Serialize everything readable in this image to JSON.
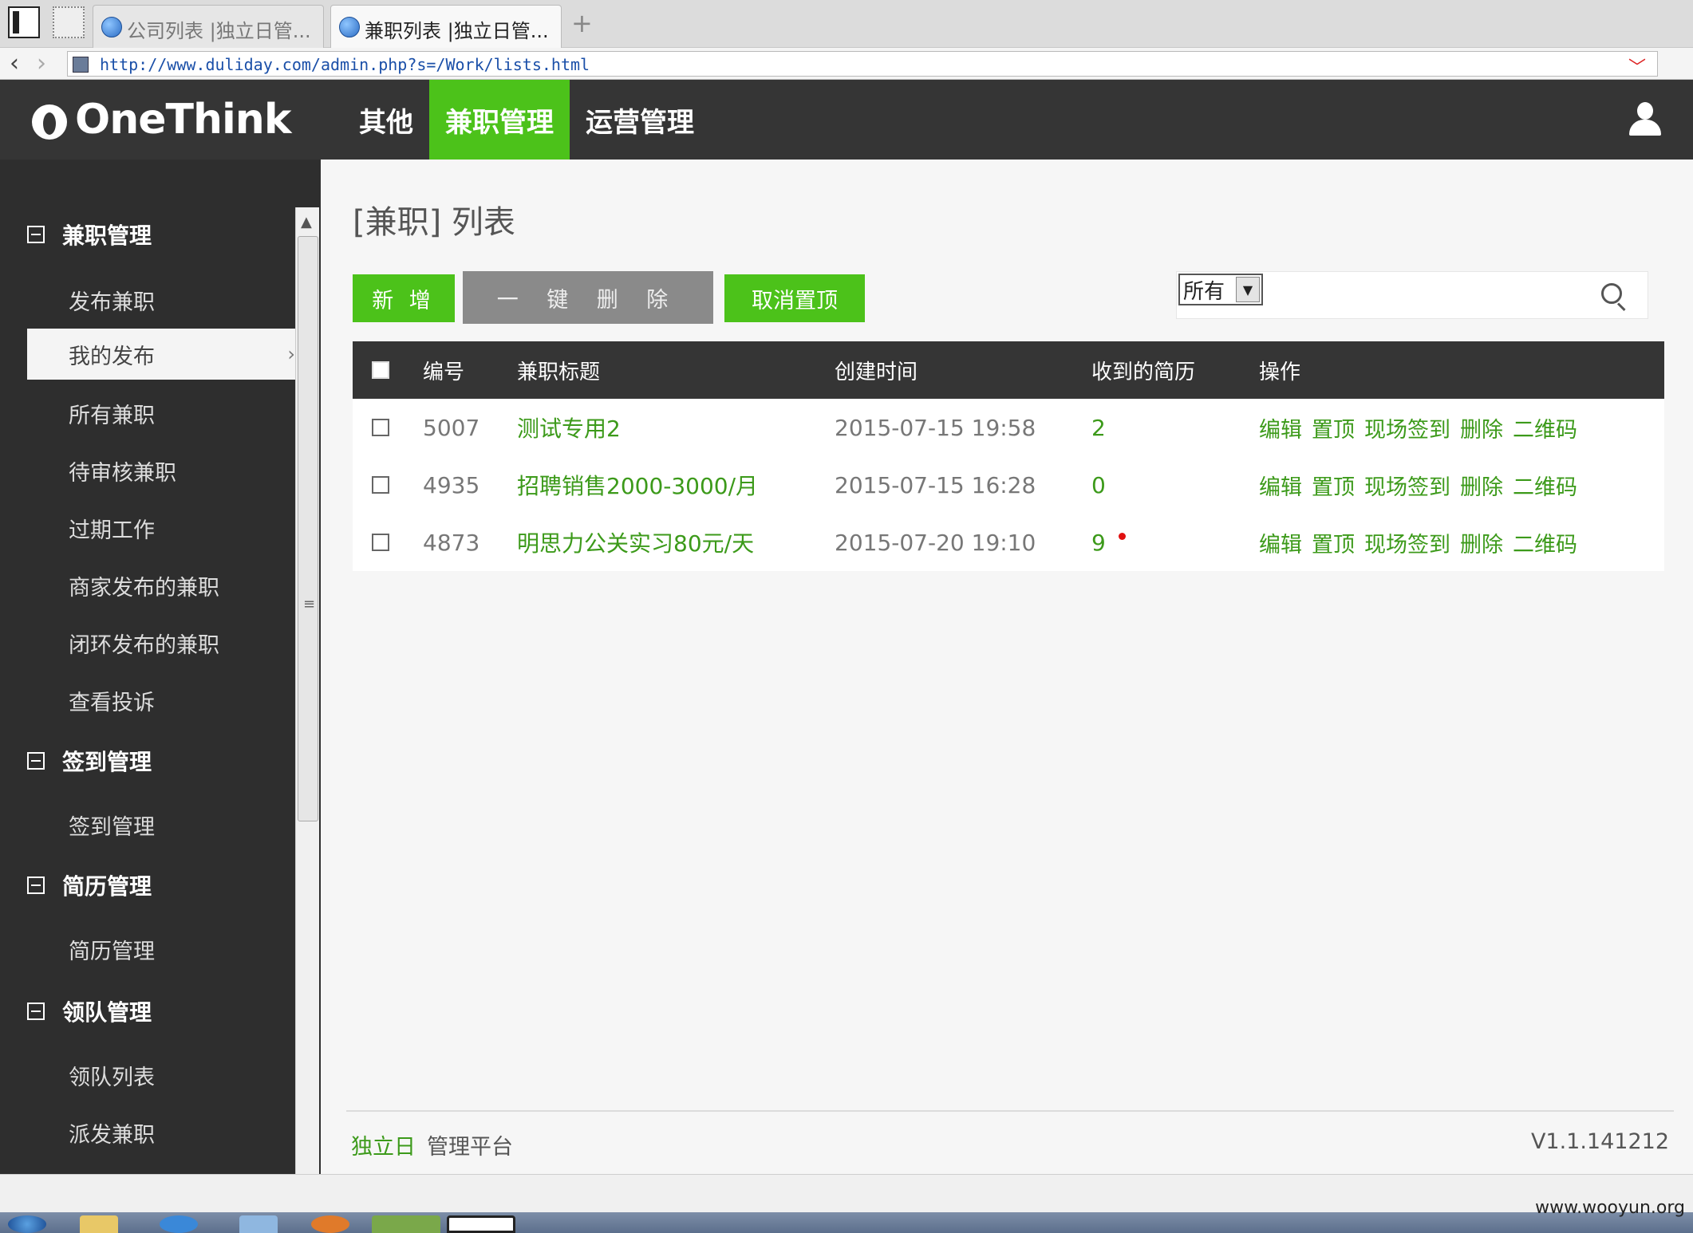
{
  "browser": {
    "tabs": [
      {
        "label": "公司列表 |独立日管..."
      },
      {
        "label": "兼职列表 |独立日管..."
      }
    ],
    "new_tab": "+",
    "url": "http://www.duliday.com/admin.php?s=/Work/lists.html"
  },
  "header": {
    "logo": "OneThink",
    "nav": [
      {
        "label": "其他"
      },
      {
        "label": "兼职管理"
      },
      {
        "label": "运营管理"
      }
    ]
  },
  "sidebar": {
    "groups": [
      {
        "label": "兼职管理",
        "items": [
          "发布兼职",
          "我的发布",
          "所有兼职",
          "待审核兼职",
          "过期工作",
          "商家发布的兼职",
          "闭环发布的兼职",
          "查看投诉"
        ]
      },
      {
        "label": "签到管理",
        "items": [
          "签到管理"
        ]
      },
      {
        "label": "简历管理",
        "items": [
          "简历管理"
        ]
      },
      {
        "label": "领队管理",
        "items": [
          "领队列表",
          "派发兼职"
        ]
      }
    ],
    "active_item": "我的发布"
  },
  "main": {
    "title": "[兼职] 列表",
    "buttons": {
      "add": "新 增",
      "delete_all": "一 键 删 除",
      "untop": "取消置顶"
    },
    "filter": {
      "selected": "所有"
    },
    "table": {
      "headers": [
        "编号",
        "兼职标题",
        "创建时间",
        "收到的简历",
        "操作"
      ],
      "rows": [
        {
          "id": "5007",
          "title": "测试专用2",
          "created": "2015-07-15 19:58",
          "resumes": "2",
          "new_flag": false
        },
        {
          "id": "4935",
          "title": "招聘销售2000-3000/月",
          "created": "2015-07-15 16:28",
          "resumes": "0",
          "new_flag": false
        },
        {
          "id": "4873",
          "title": "明思力公关实习80元/天",
          "created": "2015-07-20 19:10",
          "resumes": "9",
          "new_flag": true
        }
      ],
      "actions": [
        "编辑",
        "置顶",
        "现场签到",
        "删除",
        "二维码"
      ]
    }
  },
  "footer": {
    "brand": "独立日",
    "platform": "管理平台",
    "version": "V1.1.141212"
  },
  "watermark": "www.wooyun.org",
  "colors": {
    "accent": "#4cc21a",
    "link": "#3c9a1a",
    "header_bg": "#353535"
  }
}
